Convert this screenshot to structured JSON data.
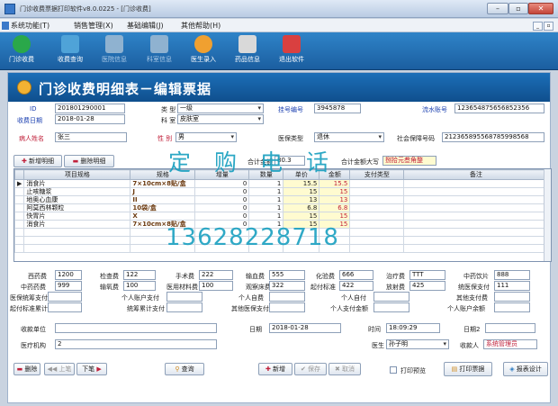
{
  "window": {
    "title": "门诊收费票据打印软件v8.0.0225 - [门诊收费]",
    "min": "–",
    "max": "▫",
    "close": "✕"
  },
  "menu": {
    "items": [
      "系统功能(T)",
      "销售管理(X)",
      "基础编辑(J)",
      "其他帮助(H)"
    ],
    "mdi": [
      "_",
      "▫"
    ]
  },
  "toolbar": {
    "buttons": [
      {
        "label": "门诊收费",
        "icon": "dollar-icon",
        "color": "#2aa84a",
        "enabled": true
      },
      {
        "label": "收费查询",
        "icon": "search-icon",
        "color": "#4fa3d8",
        "enabled": true
      },
      {
        "label": "医院信息",
        "icon": "hospital-icon",
        "color": "#8fb2d0",
        "enabled": false
      },
      {
        "label": "科室信息",
        "icon": "users-icon",
        "color": "#8fb2d0",
        "enabled": false
      },
      {
        "label": "医生录入",
        "icon": "doctor-icon",
        "color": "#f0a030",
        "enabled": true
      },
      {
        "label": "药品信息",
        "icon": "medicine-icon",
        "color": "#d9d9d9",
        "enabled": true
      },
      {
        "label": "退出软件",
        "icon": "exit-icon",
        "color": "#d94040",
        "enabled": true
      }
    ]
  },
  "form": {
    "title": "门诊收费明细表－编辑票据",
    "labels": {
      "id": "ID",
      "date": "收费日期",
      "type": "类 型",
      "dept": "科 室",
      "regno": "挂号编号",
      "serial": "流水账号",
      "name": "病人姓名",
      "gender": "性 别",
      "insurance_type": "医保类型",
      "ss_no": "社会保障号码",
      "total": "合计金额",
      "total_upper": "合计金额大写"
    },
    "values": {
      "id": "201801290001",
      "date": "2018-01-28",
      "type": "一级",
      "dept": "皮肤室",
      "regno": "3945878",
      "serial": "123654875656852356",
      "name": "张三",
      "gender": "男",
      "insurance_type": "退休",
      "ss_no": "212365895568785998568",
      "total": "80.3",
      "total_upper": "捌拾元叁角整"
    },
    "detail_buttons": {
      "add": "新增明细",
      "delete": "删除明细"
    },
    "grid": {
      "columns": [
        "项目规格",
        "规格",
        "增量",
        "数量",
        "单价",
        "金额",
        "支付类型",
        "备注"
      ],
      "rows": [
        {
          "item": "消食片",
          "spec": "7×10cm×8贴/盒",
          "inc": "0",
          "qty": "1",
          "price": "15.5",
          "amount": "15.5",
          "pay": "",
          "note": "",
          "current": true
        },
        {
          "item": "止咳糖浆",
          "spec": "J",
          "inc": "0",
          "qty": "1",
          "price": "15",
          "amount": "15",
          "pay": "",
          "note": "",
          "current": false
        },
        {
          "item": "地奥心血康",
          "spec": "II",
          "inc": "0",
          "qty": "1",
          "price": "13",
          "amount": "13",
          "pay": "",
          "note": "",
          "current": false
        },
        {
          "item": "阿莫西林颗粒",
          "spec": "10袋/盒",
          "inc": "0",
          "qty": "1",
          "price": "6.8",
          "amount": "6.8",
          "pay": "",
          "note": "",
          "current": false
        },
        {
          "item": "快胃片",
          "spec": "X",
          "inc": "0",
          "qty": "1",
          "price": "15",
          "amount": "15",
          "pay": "",
          "note": "",
          "current": false
        },
        {
          "item": "消食片",
          "spec": "7×10cm×8贴/盒",
          "inc": "0",
          "qty": "1",
          "price": "15",
          "amount": "15",
          "pay": "",
          "note": "",
          "current": false
        }
      ]
    },
    "fees": {
      "west_drug": {
        "label": "西药费",
        "value": "1200"
      },
      "exam": {
        "label": "检查费",
        "value": "122"
      },
      "surgery": {
        "label": "手术费",
        "value": "222"
      },
      "transfusion": {
        "label": "输血费",
        "value": "555"
      },
      "lab": {
        "label": "化验费",
        "value": "666"
      },
      "treatment": {
        "label": "治疗费",
        "value": "TTT"
      },
      "herbal_piece": {
        "label": "中药饮片",
        "value": "888"
      },
      "cn_drug": {
        "label": "中药药费",
        "value": "999"
      },
      "oxygen": {
        "label": "输氧费",
        "value": "100"
      },
      "material": {
        "label": "医用材料费",
        "value": "100"
      },
      "observe_bed": {
        "label": "观察床费",
        "value": "322"
      },
      "threshold": {
        "label": "起付标准",
        "value": "422"
      },
      "radiation": {
        "label": "放射费",
        "value": "425"
      },
      "insurance_pay": {
        "label": "统医保支付",
        "value": "111"
      }
    },
    "pay_labels": [
      "医保统筹支付",
      "个人账户支付",
      "个人自费",
      "个人自付",
      "其他支付费",
      "起付标准累计",
      "统筹累计支付",
      "其他医保支付",
      "个人支付金额",
      "个人账户余额"
    ],
    "bottom": {
      "unit_label": "收款单位",
      "unit_value": "",
      "date_label": "日期",
      "date_value": "2018-01-28",
      "time_label": "时间",
      "time_value": "18:09:29",
      "date2_label": "日期2",
      "date2_value": "",
      "inst_label": "医疗机构",
      "inst_value": "2",
      "doctor_label": "医生",
      "doctor_value": "孙子明",
      "cashier_label": "收款人",
      "cashier_value": "系统管理员"
    },
    "actions": {
      "delete": "删除",
      "prev": "上笔",
      "next": "下笔",
      "query": "查询",
      "add": "新增",
      "save": "保存",
      "cancel": "取消",
      "print_preview": "打印预览",
      "print": "打印票据",
      "report": "报表设计"
    }
  },
  "watermark": {
    "line1": "定购电话",
    "line2": "13628228718"
  }
}
